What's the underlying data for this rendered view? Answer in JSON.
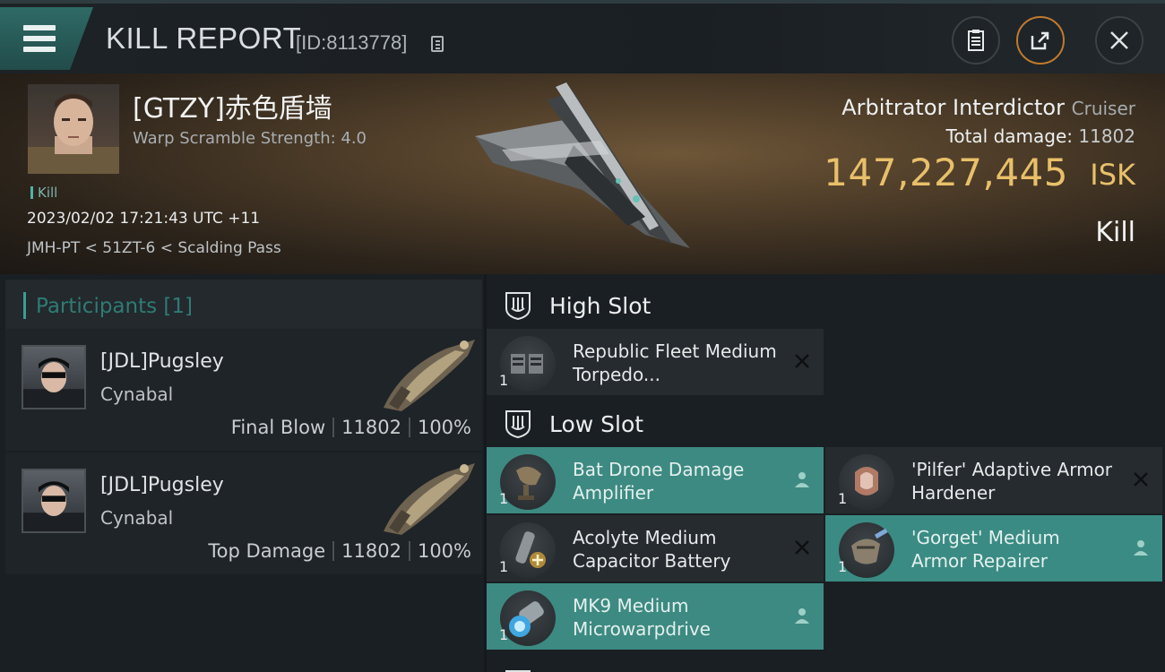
{
  "header": {
    "title": "KILL REPORT",
    "report_id": "[ID:8113778]",
    "buttons": [
      "clipboard-icon",
      "share-icon",
      "close-icon"
    ]
  },
  "victim": {
    "name": "[GTZY]赤色盾墙",
    "attribute": "Warp Scramble Strength: 4.0",
    "tag": "Kill",
    "datetime": "2023/02/02 17:21:43 UTC +11",
    "location": "JMH-PT < 51ZT-6 < Scalding Pass",
    "ship_name": "Arbitrator Interdictor",
    "ship_class": "Cruiser",
    "total_damage_label": "Total damage:",
    "total_damage": "11802",
    "isk_value": "147,227,445",
    "isk_unit": "ISK",
    "result": "Kill"
  },
  "participants": {
    "header": "Participants [1]",
    "rows": [
      {
        "name": "[JDL]Pugsley",
        "ship": "Cynabal",
        "role": "Final Blow",
        "damage": "11802",
        "percent": "100%"
      },
      {
        "name": "[JDL]Pugsley",
        "ship": "Cynabal",
        "role": "Top Damage",
        "damage": "11802",
        "percent": "100%"
      }
    ]
  },
  "fitting": {
    "high_slot_label": "High Slot",
    "low_slot_label": "Low Slot",
    "high_modules": [
      {
        "qty": "1",
        "name": "Republic Fleet Medium Torpedo...",
        "status": "destroyed"
      }
    ],
    "low_modules": [
      {
        "qty": "1",
        "name": "Bat Drone Damage Amplifier",
        "status": "dropped"
      },
      {
        "qty": "1",
        "name": "'Pilfer' Adaptive Armor Hardener",
        "status": "destroyed"
      },
      {
        "qty": "1",
        "name": "Acolyte Medium Capacitor Battery",
        "status": "destroyed"
      },
      {
        "qty": "1",
        "name": "'Gorget' Medium Armor Repairer",
        "status": "dropped"
      },
      {
        "qty": "1",
        "name": "MK9 Medium Microwarpdrive",
        "status": "dropped"
      }
    ]
  },
  "colors": {
    "accent": "#3d8a82",
    "isk": "#e8c06a",
    "background": "#1a1f23"
  }
}
